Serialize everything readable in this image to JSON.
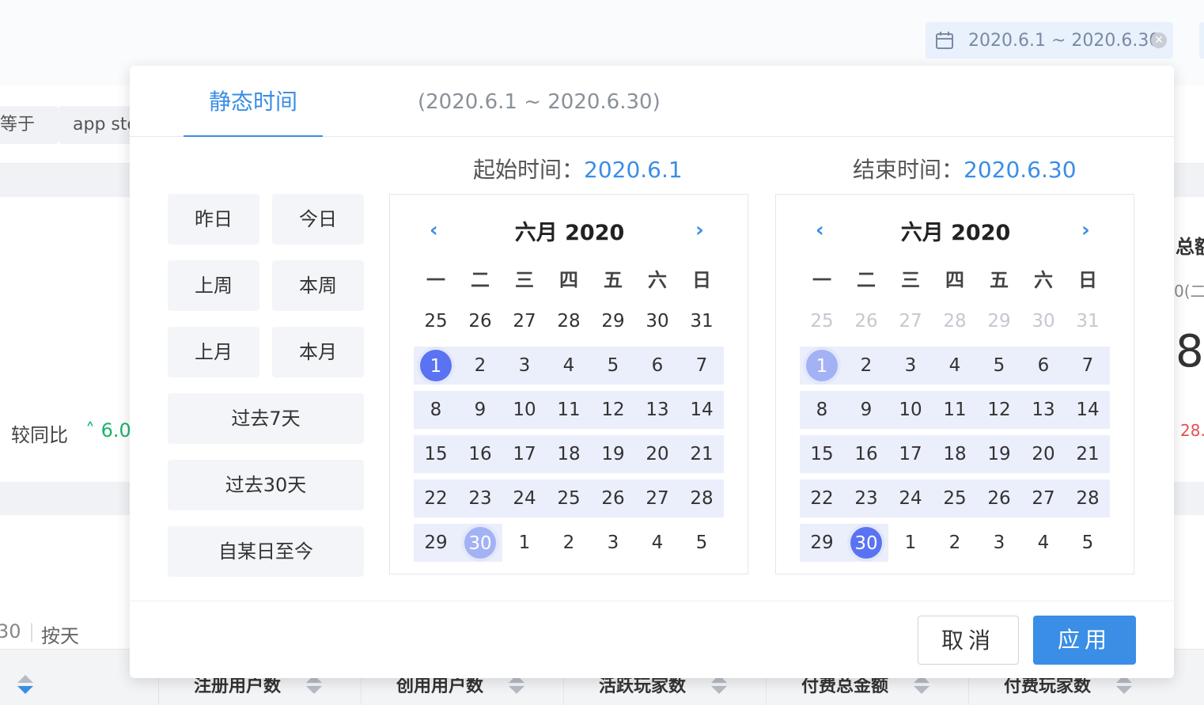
{
  "top_bar": {
    "date_range": "2020.6.1 ~ 2020.6.30",
    "clear_icon": "close-circle-icon",
    "calendar_icon": "calendar-icon"
  },
  "filters": {
    "operator_label": "等于",
    "value_label": "app sto"
  },
  "background": {
    "yoy_label": "较同比",
    "yoy_value": "6.0",
    "right_title_partial": "总额",
    "right_sub_partial": "0(二",
    "right_big_partial": "8",
    "right_red_partial": "28.",
    "left_num_partial": "30",
    "by_day": "按天",
    "table_headers": [
      "注册用户数",
      "创用用户数",
      "活跃玩家数",
      "付费总金额",
      "付费玩家数"
    ]
  },
  "modal": {
    "tab_static": "静态时间",
    "tab_range": "(2020.6.1 ~ 2020.6.30)",
    "quick": {
      "yesterday": "昨日",
      "today": "今日",
      "last_week": "上周",
      "this_week": "本周",
      "last_month": "上月",
      "this_month": "本月",
      "past7": "过去7天",
      "past30": "过去30天",
      "since": "自某日至今"
    },
    "start": {
      "label": "起始时间：",
      "value": "2020.6.1"
    },
    "end": {
      "label": "结束时间：",
      "value": "2020.6.30"
    },
    "calendar_title": "六月 2020",
    "weekdays": [
      "一",
      "二",
      "三",
      "四",
      "五",
      "六",
      "日"
    ],
    "weeks": [
      [
        "25",
        "26",
        "27",
        "28",
        "29",
        "30",
        "31"
      ],
      [
        "1",
        "2",
        "3",
        "4",
        "5",
        "6",
        "7"
      ],
      [
        "8",
        "9",
        "10",
        "11",
        "12",
        "13",
        "14"
      ],
      [
        "15",
        "16",
        "17",
        "18",
        "19",
        "20",
        "21"
      ],
      [
        "22",
        "23",
        "24",
        "25",
        "26",
        "27",
        "28"
      ],
      [
        "29",
        "30",
        "1",
        "2",
        "3",
        "4",
        "5"
      ]
    ],
    "cancel": "取消",
    "apply": "应用",
    "accent": "#3a8ee6",
    "selected_dark": "#5973f2",
    "selected_light": "#a3b1f5"
  }
}
